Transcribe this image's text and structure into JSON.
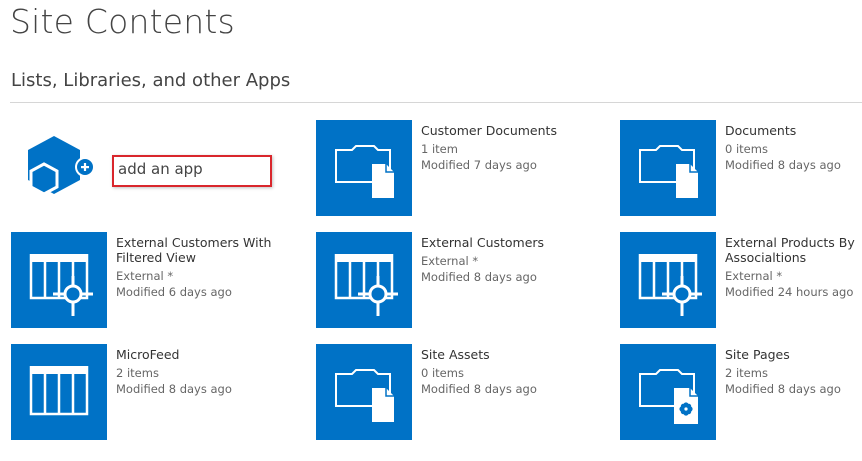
{
  "page": {
    "title": "Site Contents",
    "section": "Lists, Libraries, and other Apps"
  },
  "add_app": {
    "label": "add an app",
    "icon": "add-app-icon"
  },
  "colors": {
    "tile_blue": "#0072c6",
    "highlight_border": "#d9262c"
  },
  "apps": [
    {
      "name": "Customer Documents",
      "line1": "1 item",
      "line2": "Modified 7 days ago",
      "icon": "document-library-icon"
    },
    {
      "name": "Documents",
      "line1": "0 items",
      "line2": "Modified 8 days ago",
      "icon": "document-library-icon"
    },
    {
      "name": "External Customers With Filtered View",
      "line1": "External *",
      "line2": "Modified 6 days ago",
      "icon": "external-list-icon"
    },
    {
      "name": "External Customers",
      "line1": "External *",
      "line2": "Modified 8 days ago",
      "icon": "external-list-icon"
    },
    {
      "name": "External Products By Associaltions",
      "line1": "External *",
      "line2": "Modified 24 hours ago",
      "icon": "external-list-icon"
    },
    {
      "name": "MicroFeed",
      "line1": "2 items",
      "line2": "Modified 8 days ago",
      "icon": "list-icon"
    },
    {
      "name": "Site Assets",
      "line1": "0 items",
      "line2": "Modified 8 days ago",
      "icon": "document-library-icon"
    },
    {
      "name": "Site Pages",
      "line1": "2 items",
      "line2": "Modified 8 days ago",
      "icon": "site-pages-icon"
    }
  ]
}
